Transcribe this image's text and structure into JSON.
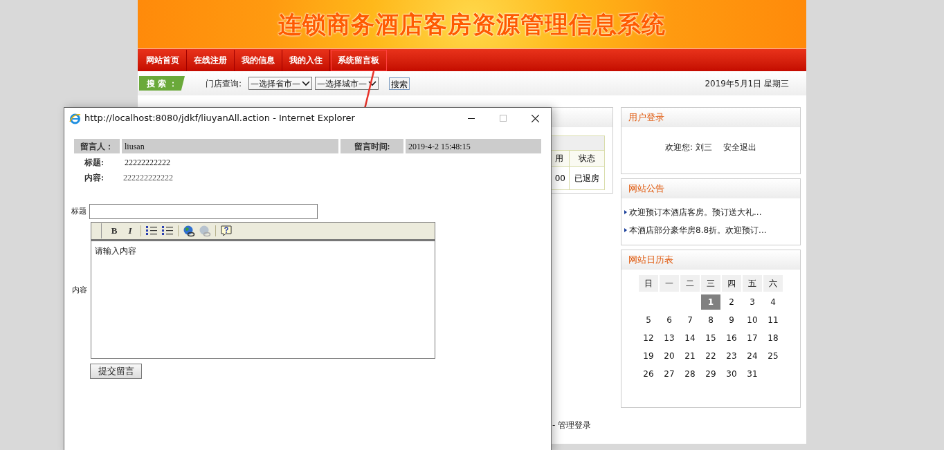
{
  "banner": {
    "title": "连锁商务酒店客房资源管理信息系统"
  },
  "nav": [
    {
      "label": "网站首页",
      "selected": false
    },
    {
      "label": "在线注册",
      "selected": false
    },
    {
      "label": "我的信息",
      "selected": false
    },
    {
      "label": "我的入住",
      "selected": false
    },
    {
      "label": "系统留言板",
      "selected": true
    }
  ],
  "search_bar": {
    "badge": "搜 索 ：",
    "label": "门店查询:",
    "province": "—选择省市—",
    "city": "—选择城市—",
    "button": "搜索",
    "date": "2019年5月1日 星期三"
  },
  "orders_table": {
    "header": [
      "用",
      "状态"
    ],
    "row": [
      "00",
      "已退房"
    ]
  },
  "login": {
    "title": "用户登录",
    "welcome": "欢迎您: 刘三",
    "logout": "安全退出"
  },
  "notices": {
    "title": "网站公告",
    "items": [
      "欢迎预订本酒店客房。预订送大礼...",
      "本酒店部分豪华房8.8折。欢迎预订..."
    ]
  },
  "calendar": {
    "title": "网站日历表",
    "weekdays": [
      "日",
      "一",
      "二",
      "三",
      "四",
      "五",
      "六"
    ],
    "weeks": [
      [
        {
          "day": "1",
          "selected": true
        },
        {
          "day": "2",
          "selected": false
        },
        {
          "day": "3",
          "selected": false
        },
        {
          "day": "4",
          "selected": false
        }
      ],
      [
        {
          "day": "5",
          "selected": false
        },
        {
          "day": "6",
          "selected": false
        },
        {
          "day": "7",
          "selected": false
        },
        {
          "day": "8",
          "selected": false
        },
        {
          "day": "9",
          "selected": false
        },
        {
          "day": "10",
          "selected": false
        },
        {
          "day": "11",
          "selected": false
        }
      ],
      [
        {
          "day": "12",
          "selected": false
        },
        {
          "day": "13",
          "selected": false
        },
        {
          "day": "14",
          "selected": false
        },
        {
          "day": "15",
          "selected": false
        },
        {
          "day": "16",
          "selected": false
        },
        {
          "day": "17",
          "selected": false
        },
        {
          "day": "18",
          "selected": false
        }
      ],
      [
        {
          "day": "19",
          "selected": false
        },
        {
          "day": "20",
          "selected": false
        },
        {
          "day": "21",
          "selected": false
        },
        {
          "day": "22",
          "selected": false
        },
        {
          "day": "23",
          "selected": false
        },
        {
          "day": "24",
          "selected": false
        },
        {
          "day": "25",
          "selected": false
        }
      ],
      [
        {
          "day": "26",
          "selected": false
        },
        {
          "day": "27",
          "selected": false
        },
        {
          "day": "28",
          "selected": false
        },
        {
          "day": "29",
          "selected": false
        },
        {
          "day": "30",
          "selected": false
        },
        {
          "day": "31",
          "selected": false
        }
      ]
    ]
  },
  "footer": {
    "text": "- 管理登录"
  },
  "popup": {
    "title": "http://localhost:8080/jdkf/liuyanAll.action - Internet Explorer",
    "message": {
      "author_label": "留言人：",
      "author": "liusan",
      "time_label": "留言时间:",
      "time": "2019-4-2 15:48:15",
      "subject_label": "标题:",
      "subject": "22222222222",
      "content_label": "内容:",
      "content": "222222222222"
    },
    "form": {
      "title_label": "标题",
      "content_label": "内容",
      "placeholder": "请输入内容",
      "submit": "提交留言",
      "toolbar": [
        {
          "kind": "bold",
          "label": "B"
        },
        {
          "kind": "italic",
          "label": "I"
        },
        {
          "kind": "separator"
        },
        {
          "kind": "ordered-list"
        },
        {
          "kind": "bullet-list"
        },
        {
          "kind": "separator"
        },
        {
          "kind": "link"
        },
        {
          "kind": "unlink"
        },
        {
          "kind": "separator"
        },
        {
          "kind": "help"
        }
      ]
    }
  }
}
